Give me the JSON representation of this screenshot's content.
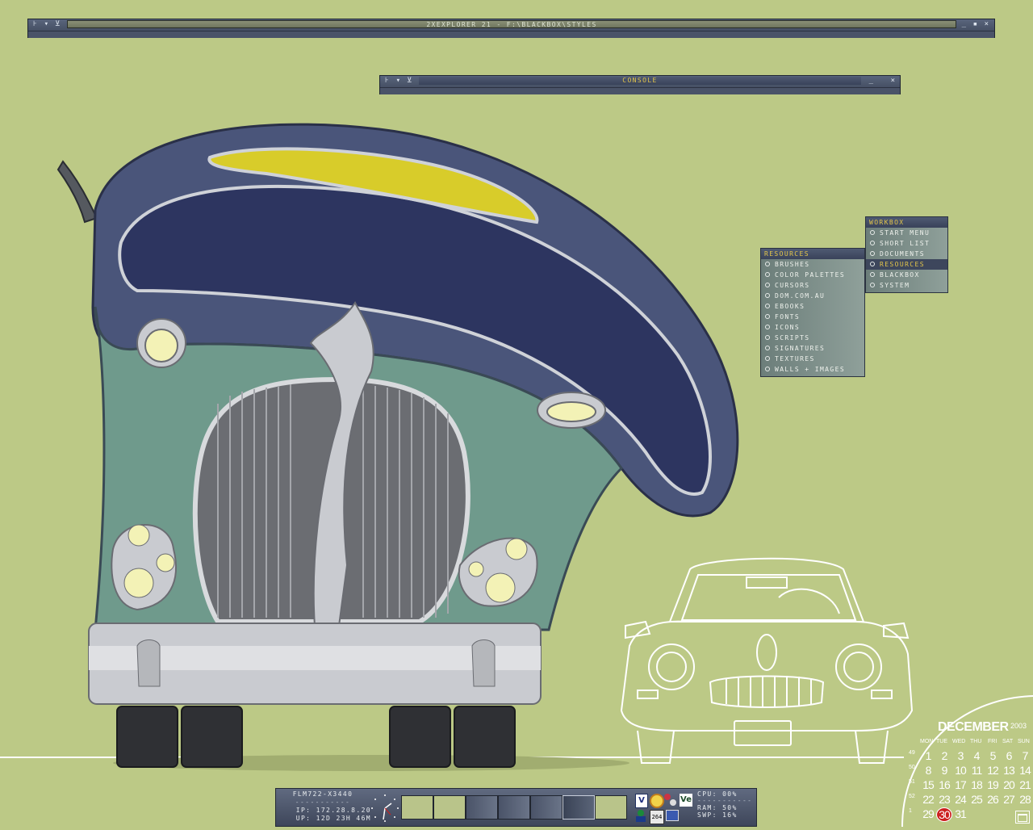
{
  "explorer_window": {
    "title": "2xExplorer 21 - F:\\Blackbox\\Styles",
    "left_buttons": [
      "⊦",
      "▾",
      "⊻"
    ],
    "right_buttons": [
      "_",
      "▪",
      "×"
    ]
  },
  "console_window": {
    "title": "Console",
    "left_buttons": [
      "⊦",
      "▾",
      "⊻"
    ],
    "right_buttons": [
      "_",
      "×"
    ]
  },
  "workbox_menu": {
    "title": "Workbox",
    "items": [
      "Start Menu",
      "Short List",
      "Documents",
      "Resources",
      "Blackbox",
      "System"
    ],
    "selected": "Resources"
  },
  "resources_menu": {
    "title": "Resources",
    "items": [
      "Brushes",
      "Color Palettes",
      "Cursors",
      "Dom.com.au",
      "eBooks",
      "Fonts",
      "Icons",
      "Scripts",
      "Signatures",
      "Textures",
      "Walls + Images"
    ]
  },
  "toolbar": {
    "host": "FLM722-X3440",
    "separator": "-----------",
    "ip": "IP: 172.28.8.20",
    "uptime": "UP: 12D 23H 46M",
    "workspace_count": 7,
    "active_workspace": 6,
    "tray_icons": [
      "shield-icon",
      "clock-app-icon",
      "network-icon",
      "ve-icon",
      "user-icon",
      "chip-icon",
      "monitor-icon"
    ],
    "tray_badge": "264",
    "cpu": "CPU: 00%",
    "ram": "RAM: 50%",
    "swp": "SWP: 16%"
  },
  "calendar": {
    "month": "DECEMBER",
    "year": "2003",
    "weekdays": [
      "MON",
      "TUE",
      "WED",
      "THU",
      "FRI",
      "SAT",
      "SUN"
    ],
    "weeks": [
      {
        "wk": "49",
        "days": [
          "1",
          "2",
          "3",
          "4",
          "5",
          "6",
          "7"
        ]
      },
      {
        "wk": "50",
        "days": [
          "8",
          "9",
          "10",
          "11",
          "12",
          "13",
          "14"
        ]
      },
      {
        "wk": "51",
        "days": [
          "15",
          "16",
          "17",
          "18",
          "19",
          "20",
          "21"
        ]
      },
      {
        "wk": "52",
        "days": [
          "22",
          "23",
          "24",
          "25",
          "26",
          "27",
          "28"
        ]
      },
      {
        "wk": "1",
        "days": [
          "29",
          "30",
          "31",
          "",
          "",
          "",
          ""
        ]
      }
    ],
    "today": "30"
  },
  "colors": {
    "background": "#bcc986",
    "accent": "#e3c54a",
    "car_body": "#4a557a",
    "car_front": "#6f9a8c",
    "today_circle": "#cc1f1f"
  }
}
